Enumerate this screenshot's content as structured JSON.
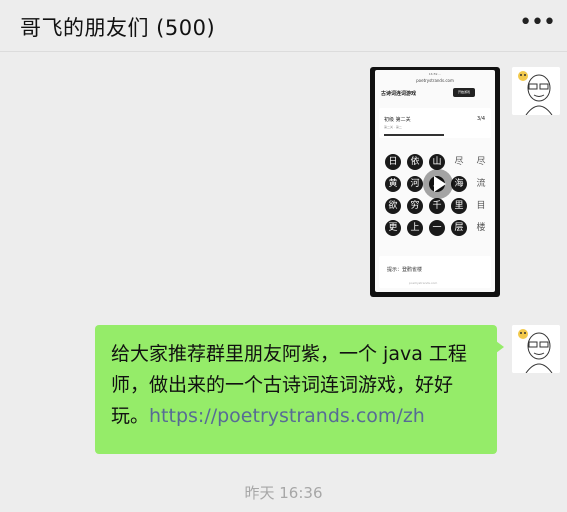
{
  "chat": {
    "title": "哥飞的朋友们 (500)",
    "more_label": "•••"
  },
  "video_message": {
    "status_text": "16:59    ...",
    "url": "poetrystrands.com",
    "app_title": "古诗词连词游戏",
    "button_label": "开始游戏",
    "level_title": "初级 第二关",
    "level_sub": "第二关 · 第二",
    "score": "3/4",
    "grid": [
      [
        "日",
        "依",
        "山",
        "尽",
        "尽"
      ],
      [
        "黄",
        "河",
        "入",
        "海",
        "流"
      ],
      [
        "欲",
        "穷",
        "千",
        "里",
        "目"
      ],
      [
        "更",
        "上",
        "一",
        "层",
        "楼"
      ]
    ],
    "bottom_line": "提示：登鹳雀楼",
    "bottom_foot": "poetrystrands.com"
  },
  "text_message": {
    "text": "给大家推荐群里朋友阿紫，一个 java 工程师，做出来的一个古诗词连词游戏，好好玩。",
    "link": "https://poetrystrands.com/zh"
  },
  "timestamp": "昨天 16:36",
  "colors": {
    "bubble_green": "#95ec69",
    "link_blue": "#576b95",
    "background": "#ededed"
  }
}
